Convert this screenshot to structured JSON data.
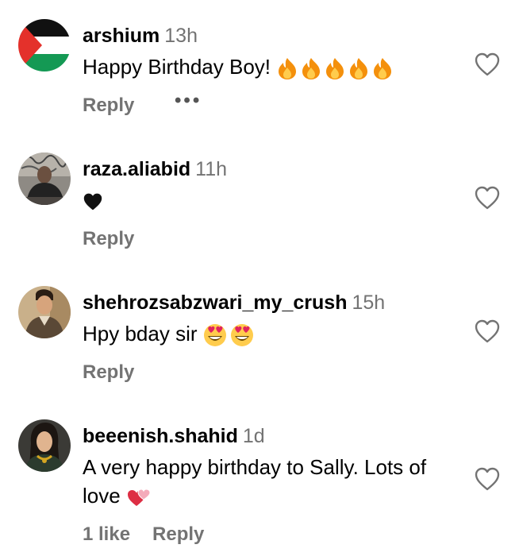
{
  "comments": [
    {
      "user": "arshium",
      "time": "13h",
      "text": "Happy Birthday Boy!",
      "emojis": [
        "fire",
        "fire",
        "fire",
        "fire",
        "fire"
      ],
      "reply_label": "Reply"
    },
    {
      "user": "raza.aliabid",
      "time": "11h",
      "text": "",
      "emojis": [
        "black-heart"
      ],
      "reply_label": "Reply"
    },
    {
      "user": "shehrozsabzwari_my_crush",
      "time": "15h",
      "text": "Hpy bday sir",
      "emojis": [
        "heart-eyes",
        "heart-eyes"
      ],
      "reply_label": "Reply"
    },
    {
      "user": "beeenish.shahid",
      "time": "1d",
      "text_line1": "A very happy birthday to Sally. Lots of",
      "text_line2": "love",
      "emojis": [
        "two-hearts"
      ],
      "likes": "1 like",
      "reply_label": "Reply"
    }
  ],
  "icons": {
    "like": "heart-outline-icon",
    "more": "more-options-icon"
  },
  "colors": {
    "secondary_text": "#737373",
    "icon_stroke": "#737373"
  }
}
